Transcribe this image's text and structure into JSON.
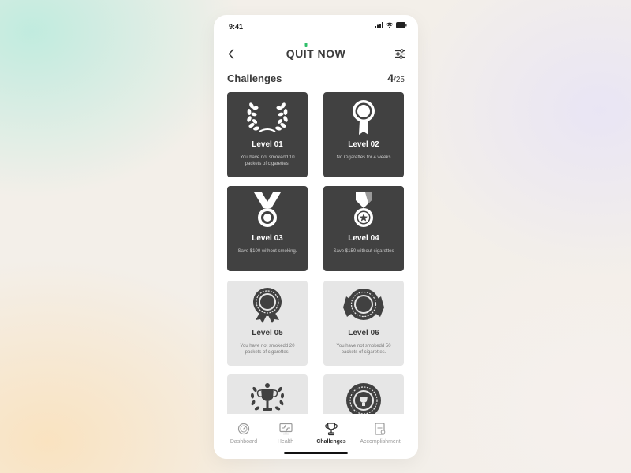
{
  "status_bar": {
    "time": "9:41"
  },
  "header": {
    "title_parts": [
      "QU",
      "I",
      "T NOW"
    ]
  },
  "section": {
    "title": "Challenges",
    "progress_done": "4",
    "progress_total": "/25"
  },
  "challenges": [
    {
      "level": "Level 01",
      "description": "You have not smokedd 10 packets of cigarettes.",
      "state": "completed",
      "icon": "laurel-wreath-icon"
    },
    {
      "level": "Level 02",
      "description": "No Cigarettes for 4 weeks",
      "state": "completed",
      "icon": "rosette-medal-icon"
    },
    {
      "level": "Level 03",
      "description": "Save $100 without smoking.",
      "state": "completed",
      "icon": "ribbon-medal-icon"
    },
    {
      "level": "Level 04",
      "description": "Save $150 without cigarettes",
      "state": "completed",
      "icon": "star-medal-icon"
    },
    {
      "level": "Level 05",
      "description": "You have not smokedd 20 packets of cigarettes.",
      "state": "locked",
      "icon": "seal-badge-icon"
    },
    {
      "level": "Level 06",
      "description": "You have not smokedd 50 packets of cigarettes.",
      "state": "locked",
      "icon": "winged-seal-icon"
    },
    {
      "level": "",
      "description": "",
      "state": "locked",
      "icon": "trophy-wreath-icon"
    },
    {
      "level": "",
      "description": "",
      "state": "locked",
      "icon": "emblem-badge-icon"
    }
  ],
  "tab_bar": {
    "tabs": [
      {
        "label": "Dashboard",
        "icon": "speedometer-icon",
        "active": false
      },
      {
        "label": "Health",
        "icon": "heart-monitor-icon",
        "active": false
      },
      {
        "label": "Challenges",
        "icon": "trophy-icon",
        "active": true
      },
      {
        "label": "Accomplishment",
        "icon": "certificate-icon",
        "active": false
      }
    ]
  },
  "colors": {
    "card_completed": "#414141",
    "card_locked": "#e6e6e6",
    "accent_green": "#2fbf6a",
    "text_primary": "#3a3a3a"
  }
}
